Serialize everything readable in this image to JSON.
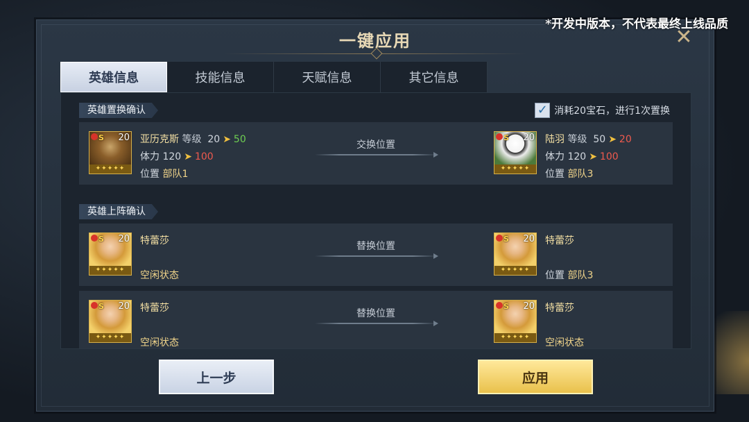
{
  "watermark": "*开发中版本，不代表最终上线品质",
  "dialog": {
    "title": "一键应用"
  },
  "tabs": [
    "英雄信息",
    "技能信息",
    "天赋信息",
    "其它信息"
  ],
  "swap_section": {
    "title": "英雄置换确认",
    "consume_label": "消耗20宝石，进行1次置换",
    "consume_checked": true,
    "action_label": "交换位置",
    "left": {
      "name": "亚历克斯",
      "level_label": "等级",
      "level_from": "20",
      "level_to": "50",
      "stamina_label": "体力",
      "stamina_from": "120",
      "stamina_to": "100",
      "position_label": "位置",
      "position": "部队1",
      "avatar_level": "20"
    },
    "right": {
      "name": "陆羽",
      "level_label": "等级",
      "level_from": "50",
      "level_to": "20",
      "stamina_label": "体力",
      "stamina_from": "120",
      "stamina_to": "100",
      "position_label": "位置",
      "position": "部队3",
      "avatar_level": "20"
    }
  },
  "deploy_section": {
    "title": "英雄上阵确认",
    "rows": [
      {
        "action_label": "替换位置",
        "left": {
          "name": "特蕾莎",
          "status": "空闲状态",
          "avatar_level": "20"
        },
        "right": {
          "name": "特蕾莎",
          "position_label": "位置",
          "position": "部队3",
          "avatar_level": "20"
        }
      },
      {
        "action_label": "替换位置",
        "left": {
          "name": "特蕾莎",
          "status": "空闲状态",
          "avatar_level": "20"
        },
        "right": {
          "name": "特蕾莎",
          "status": "空闲状态",
          "avatar_level": "20"
        }
      }
    ]
  },
  "avatar_badge": "S",
  "avatar_stars": "✦✦✦✦✦",
  "buttons": {
    "back": "上一步",
    "apply": "应用"
  },
  "colors": {
    "increase": "#6fcf52",
    "decrease": "#ef5a4e",
    "accent_gold": "#e9c14c"
  }
}
